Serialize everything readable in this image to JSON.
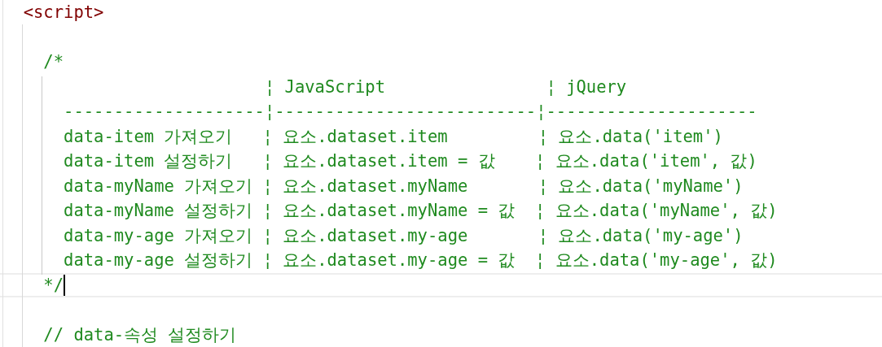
{
  "editor": {
    "lines": [
      {
        "kind": "tag",
        "text": "  <script>",
        "current": false
      },
      {
        "kind": "blank",
        "current": false
      },
      {
        "kind": "comment",
        "text": "    /*",
        "current": false
      },
      {
        "kind": "comment",
        "text": "                          ¦ JavaScript                ¦ jQuery",
        "current": false
      },
      {
        "kind": "comment",
        "text": "      --------------------¦--------------------------¦---------------------",
        "current": false
      },
      {
        "kind": "comment",
        "text": "      data-item 가져오기   ¦ 요소.dataset.item         ¦ 요소.data('item')",
        "current": false
      },
      {
        "kind": "comment",
        "text": "      data-item 설정하기   ¦ 요소.dataset.item = 값    ¦ 요소.data('item', 값)",
        "current": false
      },
      {
        "kind": "comment",
        "text": "      data-myName 가져오기 ¦ 요소.dataset.myName       ¦ 요소.data('myName')",
        "current": false
      },
      {
        "kind": "comment",
        "text": "      data-myName 설정하기 ¦ 요소.dataset.myName = 값  ¦ 요소.data('myName', 값)",
        "current": false
      },
      {
        "kind": "comment",
        "text": "      data-my-age 가져오기 ¦ 요소.dataset.my-age       ¦ 요소.data('my-age')",
        "current": false
      },
      {
        "kind": "comment",
        "text": "      data-my-age 설정하기 ¦ 요소.dataset.my-age = 값  ¦ 요소.data('my-age', 값)",
        "current": false
      },
      {
        "kind": "comment",
        "text": "    */",
        "current": true
      },
      {
        "kind": "blank",
        "current": false
      },
      {
        "kind": "comment",
        "text": "    // data-속성 설정하기",
        "current": false
      }
    ]
  }
}
